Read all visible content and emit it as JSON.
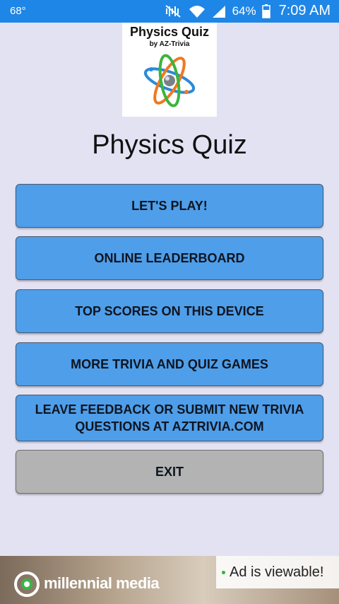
{
  "status_bar": {
    "temperature": "68°",
    "battery_percent": "64%",
    "time": "7:09 AM",
    "icons": [
      "mute-icon",
      "wifi-icon",
      "signal-icon",
      "battery-icon"
    ]
  },
  "logo": {
    "title": "Physics Quiz",
    "byline": "by AZ-Trivia",
    "graphic": "atom-icon"
  },
  "app_title": "Physics Quiz",
  "menu": {
    "play": "LET'S PLAY!",
    "leaderboard": "ONLINE LEADERBOARD",
    "top_scores": "TOP SCORES ON THIS DEVICE",
    "more_games": "MORE TRIVIA AND QUIZ GAMES",
    "feedback": "LEAVE FEEDBACK OR SUBMIT NEW TRIVIA QUESTIONS AT AZTRIVIA.COM",
    "exit": "EXIT"
  },
  "ad": {
    "brand": "millennial media",
    "viewable_text": "Ad is viewable!"
  },
  "colors": {
    "status_bar": "#1e86e6",
    "background": "#e3e2f3",
    "button": "#4f9ee9",
    "exit_button": "#b3b3b3"
  }
}
